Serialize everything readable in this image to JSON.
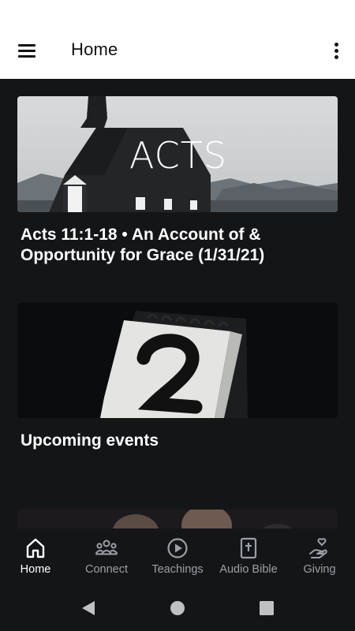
{
  "app_bar": {
    "title": "Home",
    "menu_icon": "hamburger-menu-icon",
    "overflow_icon": "more-vertical-icon"
  },
  "feed": {
    "cards": [
      {
        "image_text": "ACTS",
        "title": "Acts 11:1-18 • An Account of & Opportunity for Grace (1/31/21)"
      },
      {
        "title": "Upcoming events"
      },
      {
        "title": ""
      }
    ]
  },
  "bottom_nav": {
    "items": [
      {
        "label": "Home",
        "icon": "home-icon",
        "active": true
      },
      {
        "label": "Connect",
        "icon": "people-group-icon",
        "active": false
      },
      {
        "label": "Teachings",
        "icon": "play-circle-icon",
        "active": false
      },
      {
        "label": "Audio Bible",
        "icon": "bible-icon",
        "active": false
      },
      {
        "label": "Giving",
        "icon": "hand-heart-icon",
        "active": false
      }
    ]
  },
  "system_nav": {
    "back_icon": "back-triangle-icon",
    "home_icon": "home-circle-icon",
    "recents_icon": "recents-square-icon"
  },
  "colors": {
    "background": "#141517",
    "app_bar": "#ffffff",
    "text_primary": "#ffffff",
    "text_inactive": "#9aa0a6"
  }
}
